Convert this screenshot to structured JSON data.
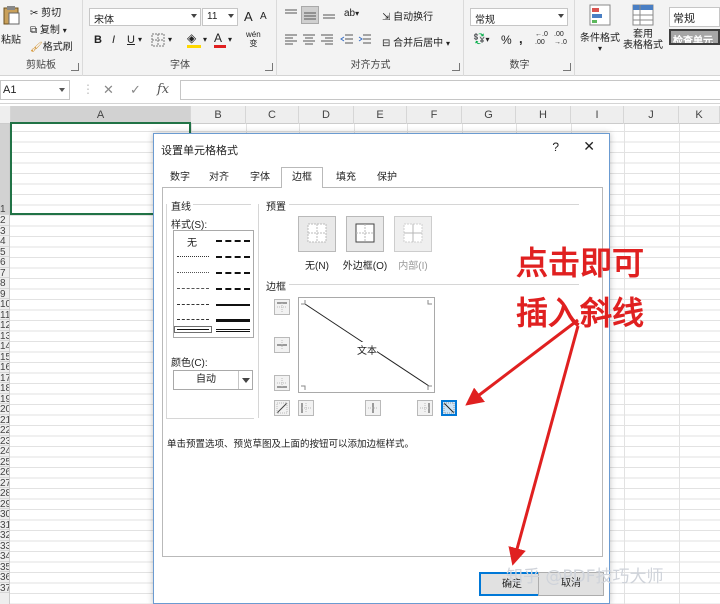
{
  "ribbon": {
    "clipboard": {
      "paste": "粘贴",
      "cut": "剪切",
      "copy": "复制",
      "format_painter": "格式刷",
      "group": "剪贴板"
    },
    "font": {
      "name": "宋体",
      "size": "11",
      "grow": "A",
      "shrink": "A",
      "bold": "B",
      "italic": "I",
      "underline": "U",
      "group": "字体",
      "phonetic": "wén",
      "phonetic_sub": "变"
    },
    "alignment": {
      "wrap": "自动换行",
      "merge": "合并后居中",
      "group": "对齐方式"
    },
    "number": {
      "format": "常规",
      "percent": "%",
      "comma": ",",
      "group": "数字"
    },
    "styles": {
      "conditional": "条件格式",
      "table_line1": "套用",
      "table_line2": "表格格式",
      "style_normal": "常规",
      "style_check": "检查单元"
    }
  },
  "formula_bar": {
    "name_box": "A1",
    "cancel": "✕",
    "enter": "✓",
    "fx": "fx"
  },
  "grid": {
    "columns": [
      "A",
      "B",
      "C",
      "D",
      "E",
      "F",
      "G",
      "H",
      "I",
      "J",
      "K"
    ],
    "rows": [
      "1",
      "2",
      "3",
      "4",
      "5",
      "6",
      "7",
      "8",
      "9",
      "10",
      "11",
      "12",
      "13",
      "14",
      "15",
      "16",
      "17",
      "18",
      "19",
      "20",
      "21",
      "22",
      "23",
      "24",
      "25",
      "26",
      "27",
      "28",
      "29",
      "30",
      "31",
      "32",
      "33",
      "34",
      "35",
      "36",
      "37"
    ]
  },
  "dialog": {
    "title": "设置单元格格式",
    "help": "?",
    "close": "✕",
    "tabs": [
      "数字",
      "对齐",
      "字体",
      "边框",
      "填充",
      "保护"
    ],
    "active_tab": "边框",
    "line_section": "直线",
    "style_label": "样式(S):",
    "style_none": "无",
    "color_label": "颜色(C):",
    "color_value": "自动",
    "presets_section": "预置",
    "preset_none": "无(N)",
    "preset_outline": "外边框(O)",
    "preset_inside": "内部(I)",
    "border_section": "边框",
    "preview_text": "文本",
    "hint": "单击预置选项、预览草图及上面的按钮可以添加边框样式。",
    "ok": "确定",
    "cancel": "取消"
  },
  "annotation": {
    "line1": "点击即可",
    "line2": "插入斜线",
    "color": "#e02020"
  },
  "watermark": "知乎 @PDF技巧大师"
}
